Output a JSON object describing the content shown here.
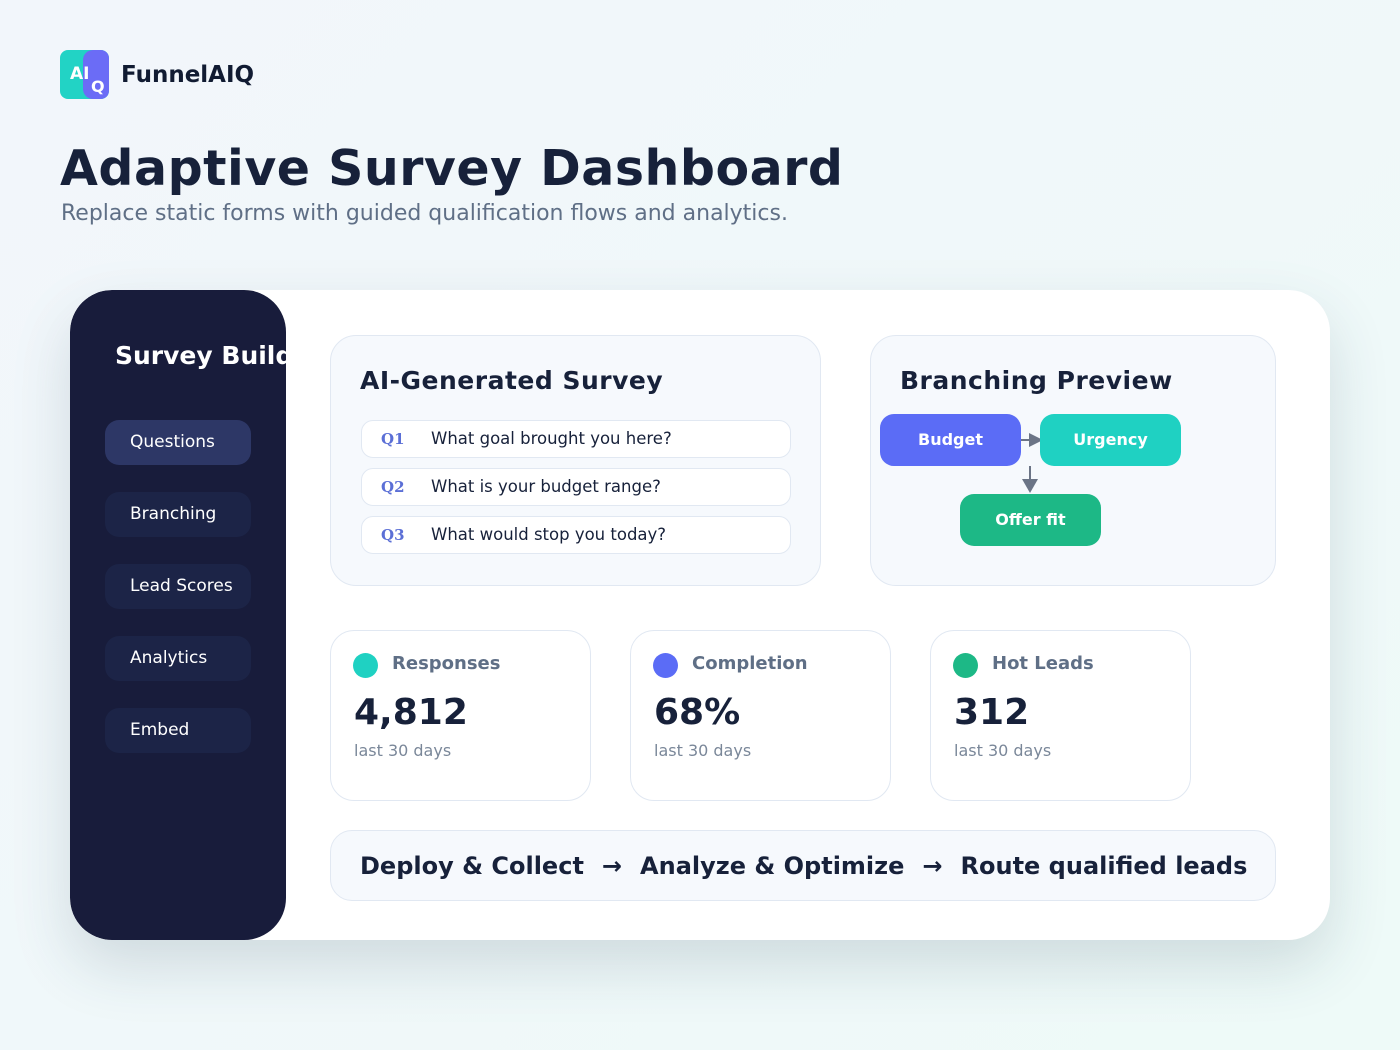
{
  "brand": {
    "logo_text_main": "AI",
    "logo_text_sub": "Q",
    "name": "FunnelAIQ"
  },
  "header": {
    "title": "Adaptive Survey Dashboard",
    "subtitle": "Replace static forms with guided qualification flows and analytics."
  },
  "sidebar": {
    "title": "Survey Builder",
    "items": [
      {
        "label": "Questions",
        "active": true
      },
      {
        "label": "Branching",
        "active": false
      },
      {
        "label": "Lead Scores",
        "active": false
      },
      {
        "label": "Analytics",
        "active": false
      },
      {
        "label": "Embed",
        "active": false
      }
    ]
  },
  "survey": {
    "title": "AI-Generated Survey",
    "questions": [
      {
        "num": "Q1",
        "text": "What goal brought you here?"
      },
      {
        "num": "Q2",
        "text": "What is your budget range?"
      },
      {
        "num": "Q3",
        "text": "What would stop you today?"
      }
    ]
  },
  "branching": {
    "title": "Branching Preview",
    "nodes": [
      {
        "label": "Budget",
        "color": "#5b6cf6"
      },
      {
        "label": "Urgency",
        "color": "#1fd1c2"
      },
      {
        "label": "Offer fit",
        "color": "#1db886"
      }
    ]
  },
  "stats": [
    {
      "label": "Responses",
      "value": "4,812",
      "period": "last 30 days",
      "color": "#1fd1c2"
    },
    {
      "label": "Completion",
      "value": "68%",
      "period": "last 30 days",
      "color": "#5b6cf6"
    },
    {
      "label": "Hot Leads",
      "value": "312",
      "period": "last 30 days",
      "color": "#1db886"
    }
  ],
  "pipeline": {
    "steps": [
      "Deploy & Collect",
      "Analyze & Optimize",
      "Route qualified leads"
    ],
    "arrow": "→"
  }
}
